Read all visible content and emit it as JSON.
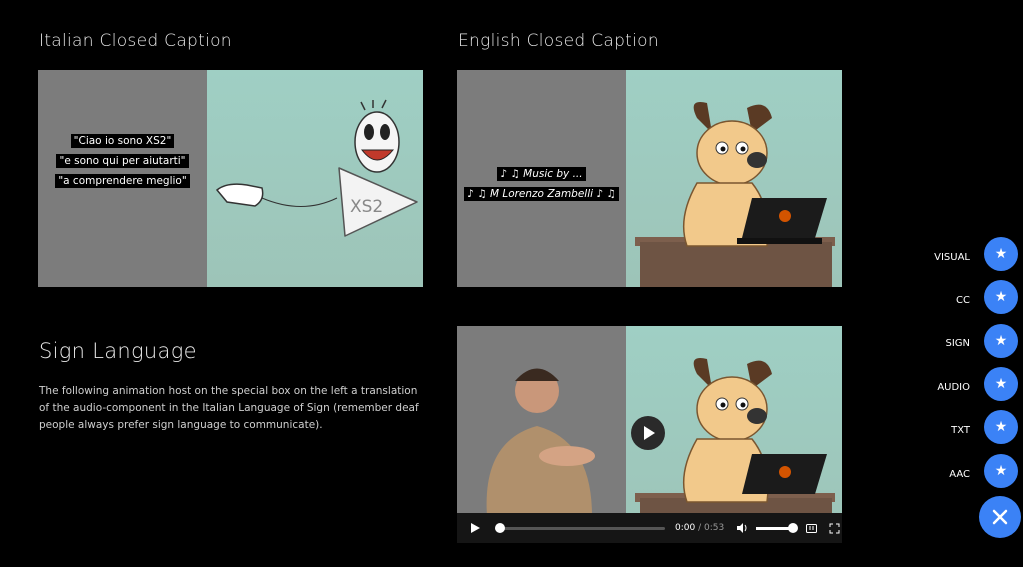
{
  "sections": {
    "italian_title": "Italian Closed Caption",
    "english_title": "English Closed Caption",
    "sign_title": "Sign Language",
    "sign_description": "The following animation host on the special box on the left a translation of the audio-component in the Italian Language of Sign (remember deaf people always prefer sign language to communicate)."
  },
  "italian_video": {
    "captions": [
      "\"Ciao io sono XS2\"",
      "\"e sono qui per aiutarti\"",
      "\"a comprendere meglio\""
    ],
    "logo_text": "XS2"
  },
  "english_video": {
    "captions": [
      "♪ ♫ Music by ...",
      "♪ ♫ M Lorenzo Zambelli ♪ ♫"
    ]
  },
  "sign_video": {
    "current_time": "0:00",
    "separator": "/",
    "duration": "0:53",
    "progress": 0.0,
    "volume": 1.0
  },
  "accessibility_menu": {
    "items": [
      {
        "label": "VISUAL",
        "icon": "star-icon"
      },
      {
        "label": "CC",
        "icon": "star-icon"
      },
      {
        "label": "SIGN",
        "icon": "star-icon"
      },
      {
        "label": "AUDIO",
        "icon": "star-icon"
      },
      {
        "label": "TXT",
        "icon": "star-icon"
      },
      {
        "label": "AAC",
        "icon": "star-icon"
      }
    ],
    "close_icon": "close-icon",
    "accent_color": "#3b82f6"
  }
}
